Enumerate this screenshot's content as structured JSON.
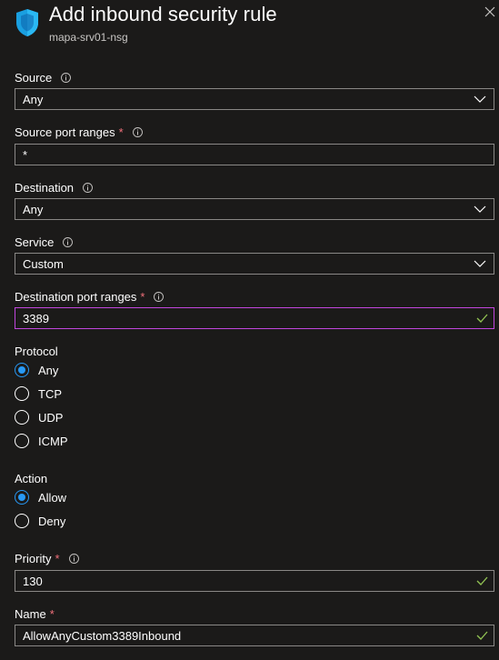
{
  "header": {
    "title": "Add inbound security rule",
    "subtitle": "mapa-srv01-nsg"
  },
  "fields": {
    "source": {
      "label": "Source",
      "value": "Any"
    },
    "source_port_ranges": {
      "label": "Source port ranges",
      "value": "*",
      "required_mark": "*"
    },
    "destination": {
      "label": "Destination",
      "value": "Any"
    },
    "service": {
      "label": "Service",
      "value": "Custom"
    },
    "destination_port_ranges": {
      "label": "Destination port ranges",
      "value": "3389",
      "required_mark": "*"
    },
    "priority": {
      "label": "Priority",
      "value": "130",
      "required_mark": "*"
    },
    "name": {
      "label": "Name",
      "value": "AllowAnyCustom3389Inbound",
      "required_mark": "*"
    }
  },
  "protocol": {
    "label": "Protocol",
    "options": [
      "Any",
      "TCP",
      "UDP",
      "ICMP"
    ],
    "selected": "Any"
  },
  "action": {
    "label": "Action",
    "options": [
      "Allow",
      "Deny"
    ],
    "selected": "Allow"
  },
  "colors": {
    "background": "#1b1a19",
    "text": "#ffffff",
    "border": "#8a8886",
    "focus_border": "#c146dd",
    "accent": "#2899f5",
    "required": "#f1707b",
    "valid": "#92c353"
  },
  "icons": {
    "header": "shield-icon",
    "close": "close-icon",
    "info": "info-icon",
    "dropdown": "chevron-down-icon",
    "valid": "checkmark-icon"
  }
}
